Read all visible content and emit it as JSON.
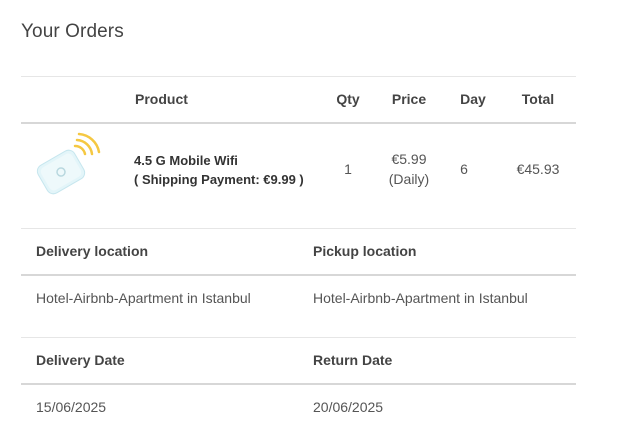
{
  "page": {
    "title": "Your Orders"
  },
  "order_table": {
    "headers": {
      "product": "Product",
      "qty": "Qty",
      "price": "Price",
      "day": "Day",
      "total": "Total"
    },
    "row": {
      "image_icon": "mobile-wifi-router-icon",
      "product_name": "4.5 G Mobile Wifi",
      "shipping_note": "( Shipping Payment: €9.99 )",
      "qty": "1",
      "price": "€5.99",
      "price_period": "(Daily)",
      "day": "6",
      "total": "€45.93"
    }
  },
  "locations": {
    "delivery_label": "Delivery location",
    "pickup_label": "Pickup location",
    "delivery_value": "Hotel-Airbnb-Apartment in Istanbul",
    "pickup_value": "Hotel-Airbnb-Apartment in Istanbul"
  },
  "dates": {
    "delivery_label": "Delivery Date",
    "return_label": "Return Date",
    "delivery_value": "15/06/2025",
    "return_value": "20/06/2025"
  },
  "colors": {
    "wifi_waves": "#f5c842",
    "device_body": "#dff3f7"
  }
}
